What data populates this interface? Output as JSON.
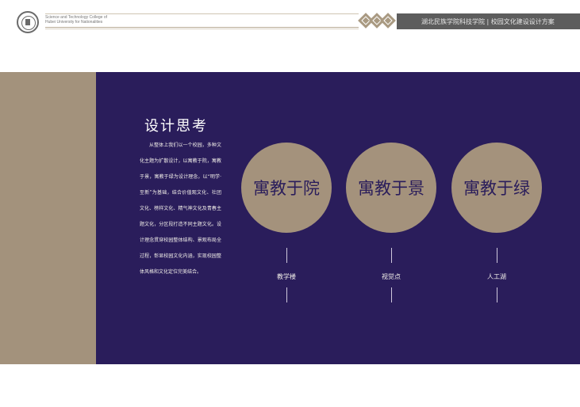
{
  "header": {
    "school_name_en_line1": "Science and Technology College of",
    "school_name_en_line2": "Hubei University for Nationalities",
    "title_bar": "湖北民族学院科技学院 | 校园文化建设设计方案",
    "accent_color": "#a4927c",
    "bar_color": "#5d5d5d"
  },
  "content": {
    "title": "设计思考",
    "paragraph": "从整体上我们以一个校园，多种文化主题为扩散设计，以寓教于院，寓教于景，寓教于绿为设计理念，以“明学·至新”为基础，结合价值观文化、社团文化、榜样文化、精气神文化及青春主题文化，分区段打造不同主题文化。设计理念贯穿校园整体结构、景观布局全过程，彰显校园文化内涵，实现校园整体风格和文化定位完美结合。",
    "background_color": "#2a1d5b",
    "circles": [
      {
        "label": "寓教于院",
        "caption": "教学楼"
      },
      {
        "label": "寓教于景",
        "caption": "视觉点"
      },
      {
        "label": "寓教于绿",
        "caption": "人工湖"
      }
    ]
  }
}
